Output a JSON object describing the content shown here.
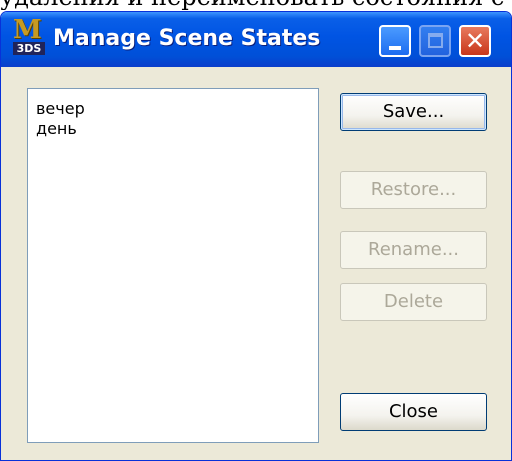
{
  "cropped_caption": "удаления и переименовать состояния с",
  "window": {
    "title": "Manage Scene States",
    "icon_top": "M",
    "icon_bottom": "3DS"
  },
  "titlebar_buttons": {
    "close_glyph": "✕"
  },
  "states_list": {
    "items": [
      "вечер",
      "день"
    ]
  },
  "buttons": {
    "save": "Save...",
    "restore": "Restore...",
    "rename": "Rename...",
    "delete": "Delete",
    "close": "Close"
  },
  "colors": {
    "titlebar": "#0054e3",
    "window_bg": "#ece9d8",
    "disabled_text": "#aca899"
  }
}
